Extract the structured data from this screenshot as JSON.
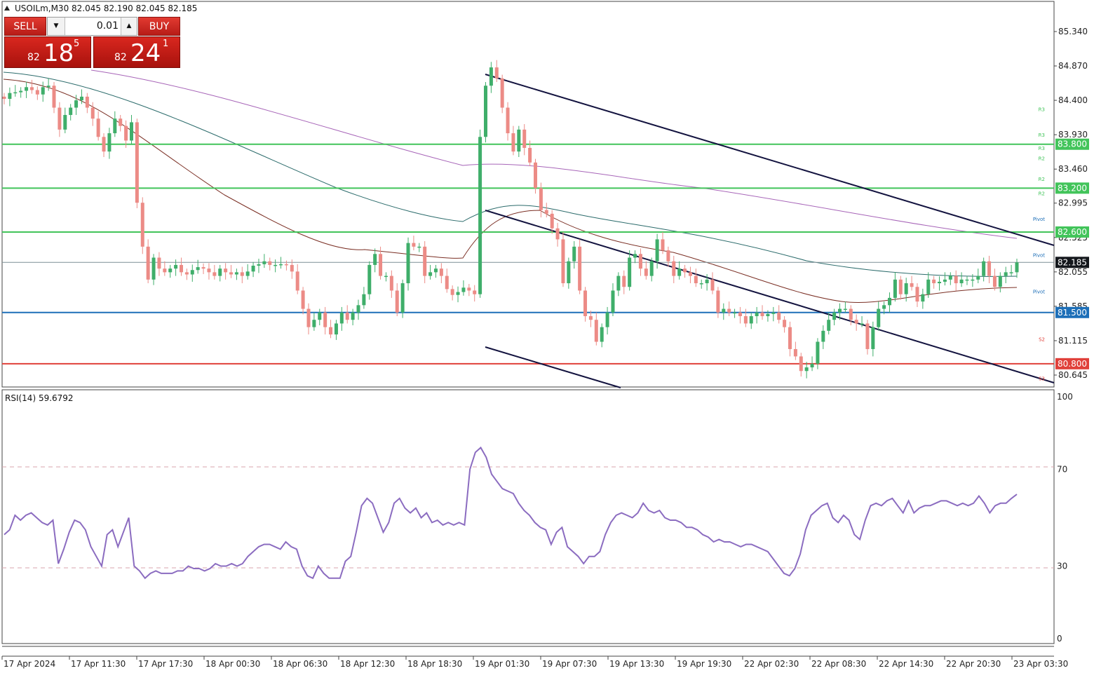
{
  "header": {
    "symbol_line": "USOILm,M30  82.045 82.190 82.045 82.185",
    "collapse_icon": "triangle-up-icon"
  },
  "trade_panel": {
    "sell_label": "SELL",
    "buy_label": "BUY",
    "lot_value": "0.01",
    "sell_price": {
      "small": "82",
      "big": "18",
      "sup": "5"
    },
    "buy_price": {
      "small": "82",
      "big": "24",
      "sup": "1"
    }
  },
  "colors": {
    "bull": "#3fae6a",
    "bear": "#ec8b86",
    "level_green": "#42c45a",
    "level_blue": "#1d6fb8",
    "level_red": "#e0403a",
    "channel": "#13133f",
    "rsi": "#8b6cc0",
    "ma_fast": "#7a2e23",
    "ma_mid": "#2b6b6b",
    "ma_slow": "#a765b8"
  },
  "chart_data": [
    {
      "type": "candlestick",
      "symbol": "USOILm",
      "timeframe": "M30",
      "ohlc_last": {
        "open": 82.045,
        "high": 82.19,
        "low": 82.045,
        "close": 82.185
      },
      "y_ticks": [
        "85.340",
        "84.870",
        "84.400",
        "83.930",
        "83.460",
        "82.995",
        "82.525",
        "82.055",
        "81.585",
        "81.115",
        "80.645"
      ],
      "x_ticks": [
        "17 Apr 2024",
        "17 Apr 11:30",
        "17 Apr 17:30",
        "18 Apr 00:30",
        "18 Apr 06:30",
        "18 Apr 12:30",
        "18 Apr 18:30",
        "19 Apr 01:30",
        "19 Apr 07:30",
        "19 Apr 13:30",
        "19 Apr 19:30",
        "22 Apr 02:30",
        "22 Apr 08:30",
        "22 Apr 14:30",
        "22 Apr 20:30",
        "23 Apr 03:30"
      ],
      "ylim": [
        80.55,
        85.55
      ],
      "current_price_label": "82.185",
      "levels": [
        {
          "price": 83.8,
          "label": "83.800",
          "kind": "resistance"
        },
        {
          "price": 83.2,
          "label": "83.200",
          "kind": "resistance"
        },
        {
          "price": 82.6,
          "label": "82.600",
          "kind": "resistance"
        },
        {
          "price": 81.5,
          "label": "81.500",
          "kind": "support"
        },
        {
          "price": 80.8,
          "label": "80.800",
          "kind": "support"
        }
      ],
      "pivot_markers": [
        {
          "label": "R3",
          "price": 84.27
        },
        {
          "label": "R3",
          "price": 83.92
        },
        {
          "label": "R3",
          "price": 83.74
        },
        {
          "label": "R2",
          "price": 83.6
        },
        {
          "label": "R2",
          "price": 83.32
        },
        {
          "label": "R2",
          "price": 83.12
        },
        {
          "label": "Pivot",
          "price": 82.77
        },
        {
          "label": "Pivot",
          "price": 82.28
        },
        {
          "label": "Pivot",
          "price": 81.78
        },
        {
          "label": "S2",
          "price": 81.13
        },
        {
          "label": "S3",
          "price": 80.59
        }
      ],
      "close_series": [
        84.42,
        84.5,
        84.51,
        84.53,
        84.58,
        84.54,
        84.48,
        84.58,
        84.6,
        84.3,
        84.0,
        84.2,
        84.3,
        84.4,
        84.45,
        84.3,
        84.15,
        83.9,
        83.7,
        83.95,
        84.15,
        84.05,
        83.85,
        84.1,
        83.0,
        82.4,
        81.95,
        82.25,
        82.1,
        82.05,
        82.1,
        82.15,
        82.05,
        82.02,
        82.08,
        82.12,
        82.1,
        82.05,
        82.0,
        82.1,
        82.05,
        82.02,
        82.05,
        82.0,
        82.06,
        82.14,
        82.16,
        82.2,
        82.15,
        82.15,
        82.16,
        82.15,
        82.06,
        81.8,
        81.55,
        81.3,
        81.4,
        81.5,
        81.3,
        81.2,
        81.35,
        81.5,
        81.4,
        81.5,
        81.6,
        81.75,
        82.15,
        82.3,
        82.0,
        82.0,
        81.8,
        81.5,
        81.9,
        82.45,
        82.4,
        82.4,
        82.0,
        82.05,
        82.1,
        82.0,
        81.82,
        81.74,
        81.78,
        81.84,
        81.8,
        81.75,
        83.9,
        84.6,
        84.85,
        84.7,
        84.3,
        83.95,
        83.7,
        84.0,
        83.75,
        83.55,
        83.2,
        82.9,
        82.85,
        82.65,
        82.5,
        81.9,
        82.2,
        82.4,
        81.8,
        81.45,
        81.4,
        81.1,
        81.3,
        81.5,
        81.8,
        82.0,
        81.85,
        82.25,
        82.3,
        82.1,
        82.0,
        82.2,
        82.5,
        82.35,
        82.2,
        82.0,
        82.1,
        82.05,
        82.0,
        81.9,
        81.9,
        81.95,
        81.8,
        81.5,
        81.55,
        81.5,
        81.5,
        81.45,
        81.35,
        81.45,
        81.5,
        81.45,
        81.48,
        81.5,
        81.4,
        81.3,
        81.0,
        80.9,
        80.7,
        80.75,
        80.8,
        81.1,
        81.25,
        81.4,
        81.5,
        81.55,
        81.55,
        81.4,
        81.35,
        81.35,
        81.0,
        81.3,
        81.55,
        81.6,
        81.7,
        81.95,
        81.75,
        81.9,
        81.85,
        81.65,
        81.75,
        81.95,
        81.9,
        81.92,
        81.95,
        82.0,
        81.9,
        81.95,
        81.95,
        81.95,
        82.0,
        82.2,
        82.0,
        81.85,
        82.0,
        82.05,
        82.05,
        82.185
      ],
      "series": [
        {
          "name": "RSI(14)",
          "value_label": "RSI(14) 59.6792",
          "ylim": [
            0,
            100
          ],
          "y_ticks": [
            "100",
            "70",
            "30",
            "0"
          ],
          "levels": [
            70,
            30
          ],
          "values": [
            43,
            45,
            51,
            49,
            51,
            52,
            50,
            48,
            47,
            49,
            31,
            37,
            44,
            49,
            48,
            45,
            38,
            34,
            30,
            43,
            45,
            38,
            44,
            50,
            30,
            28,
            25,
            27,
            28,
            27,
            27,
            27,
            28,
            28,
            30,
            29,
            29,
            28,
            29,
            31,
            30,
            30,
            31,
            30,
            31,
            34,
            36,
            38,
            39,
            39,
            38,
            37,
            40,
            38,
            37,
            30,
            26,
            25,
            30,
            27,
            25,
            25,
            25,
            32,
            34,
            44,
            55,
            58,
            56,
            50,
            44,
            48,
            56,
            58,
            54,
            52,
            54,
            50,
            52,
            48,
            49,
            47,
            48,
            47,
            48,
            47,
            70,
            77,
            79,
            75,
            68,
            65,
            62,
            61,
            60,
            56,
            53,
            51,
            48,
            46,
            45,
            39,
            44,
            46,
            38,
            36,
            34,
            31,
            34,
            34,
            36,
            43,
            48,
            51,
            52,
            51,
            50,
            52,
            56,
            53,
            52,
            53,
            50,
            49,
            49,
            48,
            46,
            46,
            45,
            43,
            42,
            40,
            41,
            40,
            40,
            39,
            38,
            39,
            39,
            38,
            37,
            36,
            33,
            30,
            27,
            26,
            29,
            35,
            45,
            51,
            53,
            55,
            56,
            50,
            48,
            51,
            49,
            43,
            41,
            49,
            55,
            56,
            55,
            57,
            58,
            55,
            52,
            57,
            52,
            54,
            55,
            55,
            56,
            57,
            57,
            56,
            55,
            56,
            55,
            56,
            59,
            56,
            52,
            55,
            56,
            56,
            58,
            59.68
          ]
        }
      ]
    }
  ]
}
